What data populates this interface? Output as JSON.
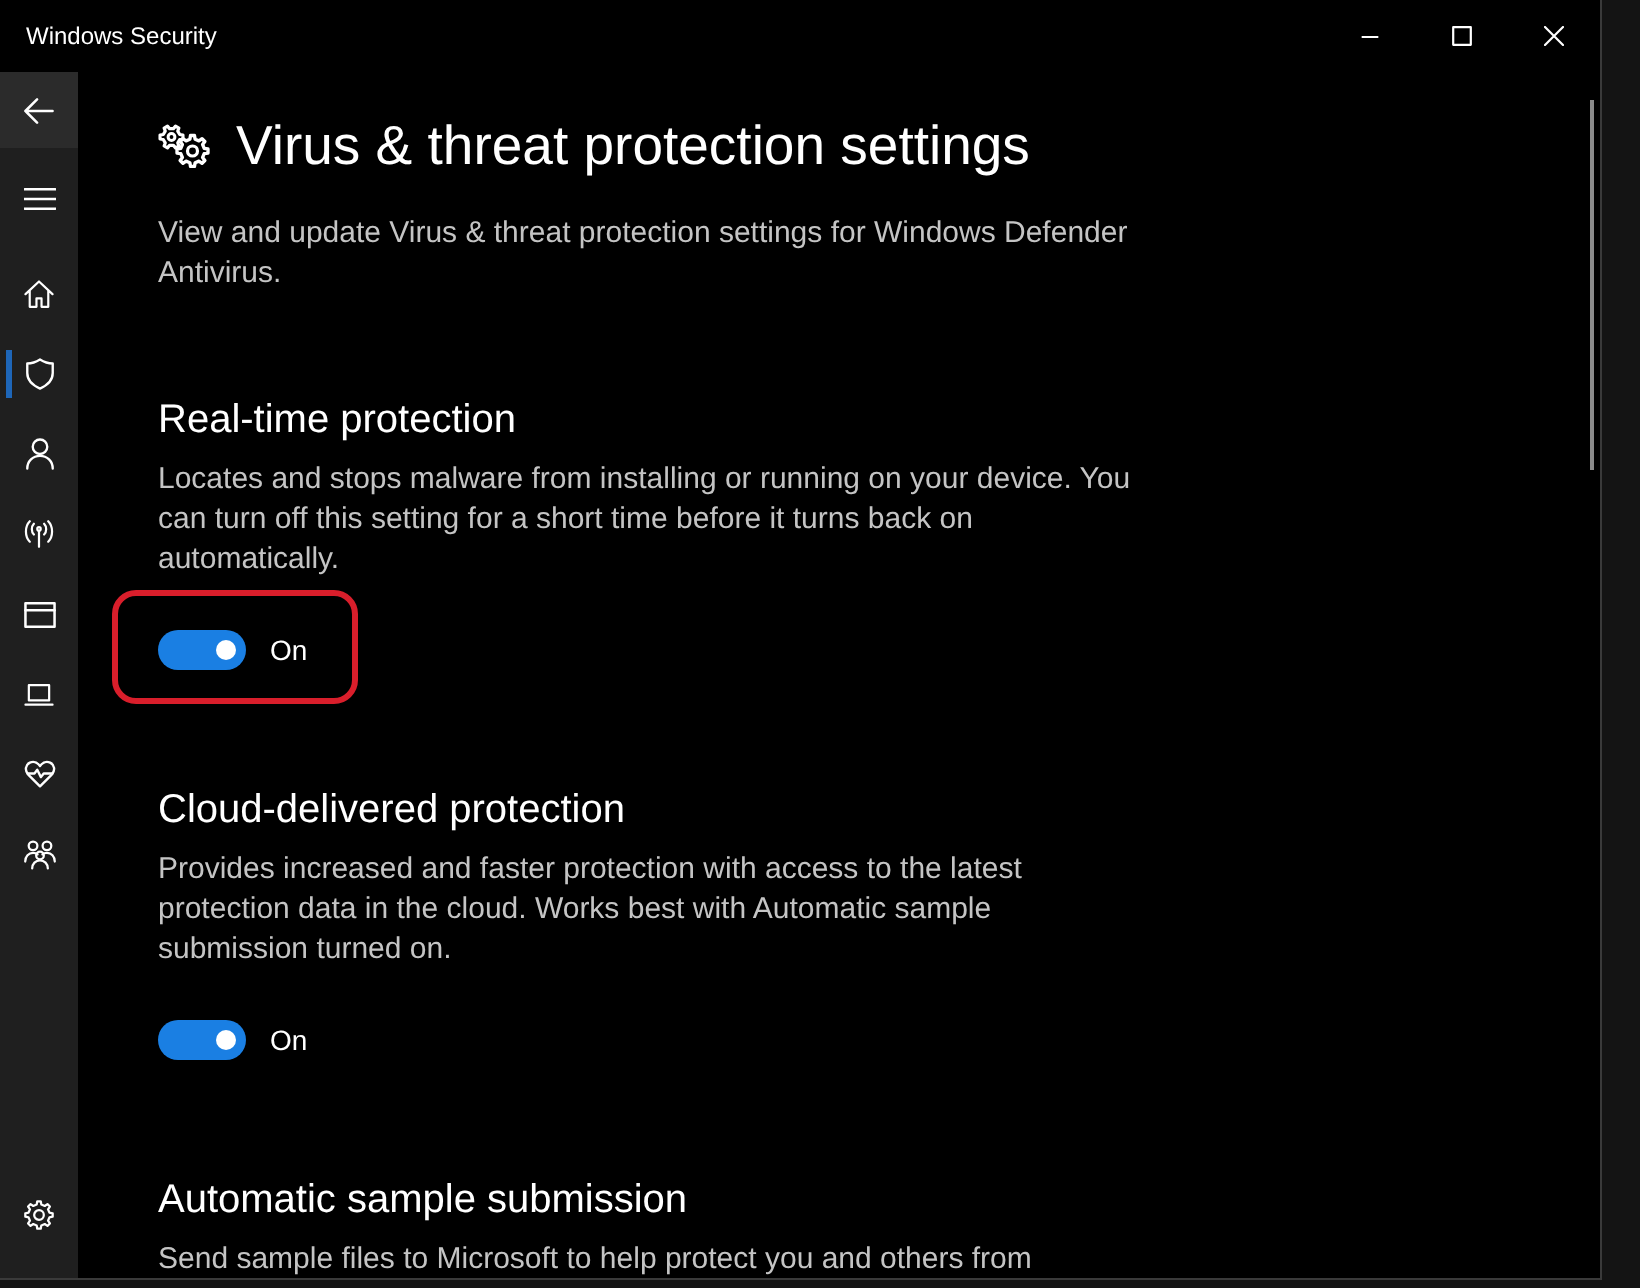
{
  "window": {
    "title": "Windows Security"
  },
  "sidebar": {
    "nav": [
      {
        "selected": false
      },
      {
        "selected": true
      },
      {
        "selected": false
      },
      {
        "selected": false
      },
      {
        "selected": false
      },
      {
        "selected": false
      },
      {
        "selected": false
      },
      {
        "selected": false
      }
    ],
    "footer": [
      {
        "selected": false
      }
    ]
  },
  "page": {
    "title": "Virus & threat protection settings",
    "description": "View and update Virus & threat protection settings for Windows Defender Antivirus."
  },
  "settings": [
    {
      "title": "Real-time protection",
      "description": "Locates and stops malware from installing or running on your device. You can turn off this setting for a short time before it turns back on automatically.",
      "toggle": {
        "on": true,
        "label": "On"
      },
      "highlighted": true
    },
    {
      "title": "Cloud-delivered protection",
      "description": "Provides increased and faster protection with access to the latest protection data in the cloud. Works best with Automatic sample submission turned on.",
      "toggle": {
        "on": true,
        "label": "On"
      },
      "highlighted": false
    },
    {
      "title": "Automatic sample submission",
      "description": "Send sample files to Microsoft to help protect you and others from",
      "highlighted": false
    }
  ]
}
